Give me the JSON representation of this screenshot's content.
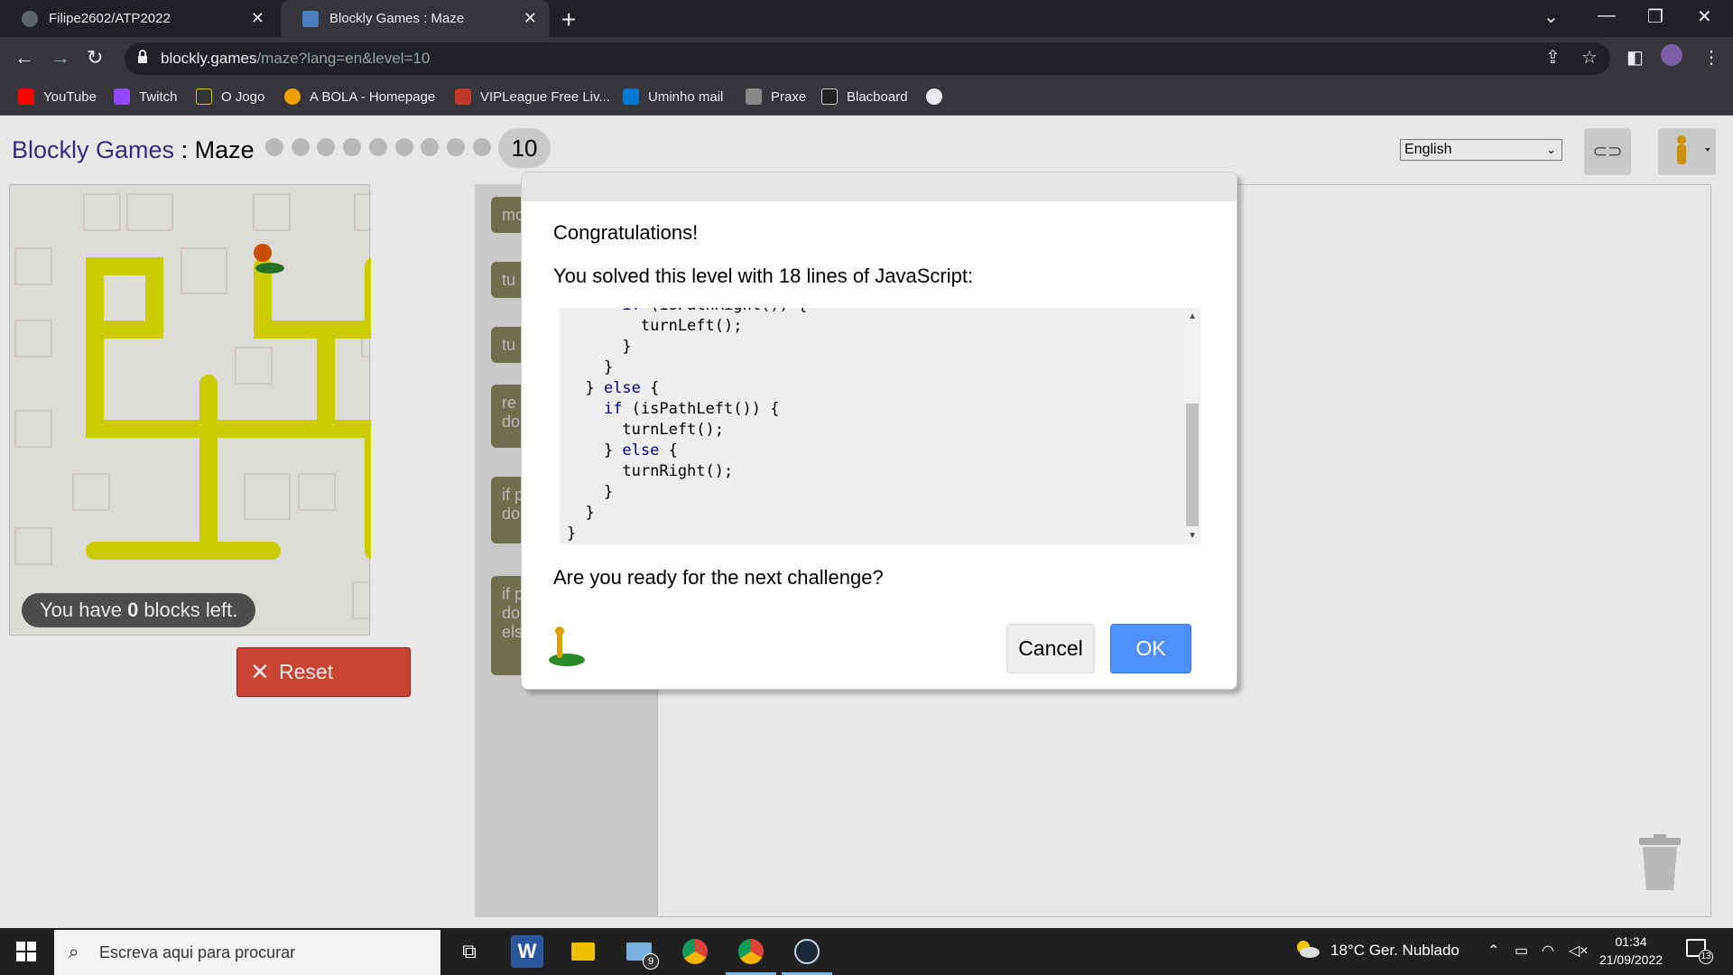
{
  "browser": {
    "tabs": [
      {
        "title": "Filipe2602/ATP2022",
        "active": false
      },
      {
        "title": "Blockly Games : Maze",
        "active": true
      }
    ],
    "url_host": "blockly.games",
    "url_path": "/maze?lang=en&level=10",
    "bookmarks": [
      {
        "label": "YouTube",
        "icon": "youtube-icon"
      },
      {
        "label": "Twitch",
        "icon": "twitch-icon"
      },
      {
        "label": "O Jogo",
        "icon": "ojogo-icon"
      },
      {
        "label": "A BOLA - Homepage",
        "icon": "abola-icon"
      },
      {
        "label": "VIPLeague Free Liv...",
        "icon": "vipleague-icon"
      },
      {
        "label": "Uminho mail",
        "icon": "outlook-icon"
      },
      {
        "label": "Praxe",
        "icon": "praxe-icon"
      },
      {
        "label": "Blacboard",
        "icon": "blackboard-icon"
      }
    ]
  },
  "game": {
    "brand": "Blockly Games",
    "separator": " : ",
    "page": "Maze",
    "level": "10",
    "completed_levels": 9,
    "language": "English",
    "blocks_left_prefix": "You have ",
    "blocks_left_count": "0",
    "blocks_left_suffix": " blocks left.",
    "reset_label": "Reset",
    "toolbox_blocks": [
      "mo",
      "tu",
      "tu",
      "re do",
      "if p do",
      "if p do els"
    ]
  },
  "dialog": {
    "congrats": "Congratulations!",
    "solved": "You solved this level with 18 lines of JavaScript:",
    "code_lines": [
      "      if (isPathRight()) {",
      "        turnLeft();",
      "      }",
      "    }",
      "  } else {",
      "    if (isPathLeft()) {",
      "      turnLeft();",
      "    } else {",
      "      turnRight();",
      "    }",
      "  }",
      "}"
    ],
    "next_question": "Are you ready for the next challenge?",
    "cancel_label": "Cancel",
    "ok_label": "OK"
  },
  "taskbar": {
    "search_placeholder": "Escreva aqui para procurar",
    "weather": "18°C  Ger. Nublado",
    "mail_badge": "9",
    "time": "01:34",
    "date": "21/09/2022",
    "notification_count": "13"
  },
  "colors": {
    "brand": "#3f2f8e",
    "reset": "#dd4b39",
    "ok": "#4d90fe",
    "maze_path": "#e0e000"
  }
}
